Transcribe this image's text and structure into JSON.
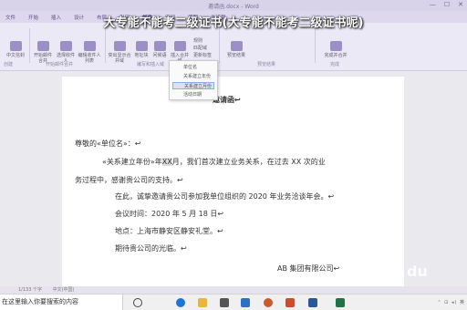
{
  "overlay_title": "大专能不能考二级证书(大专能不能考二级证书呢)",
  "window": {
    "title": "邀请函.docx - Word",
    "controls": [
      "—",
      "☐",
      "✕"
    ]
  },
  "menu": [
    "文件",
    "开始",
    "插入",
    "设计",
    "布局",
    "引用",
    "邮件",
    "审阅",
    "视图",
    "告诉我"
  ],
  "ribbon": {
    "buttons": [
      {
        "label": "中文信封",
        "icon": "envelope-icon"
      },
      {
        "label": "开始邮件合并",
        "icon": "mail-merge-icon"
      },
      {
        "label": "选择收件人",
        "icon": "recipients-icon"
      },
      {
        "label": "编辑收件人列表",
        "icon": "edit-list-icon"
      },
      {
        "label": "突出显示合并域",
        "icon": "highlight-fields-icon"
      },
      {
        "label": "地址块",
        "icon": "address-block-icon"
      },
      {
        "label": "问候语",
        "icon": "greeting-icon"
      },
      {
        "label": "插入合并域",
        "icon": "insert-field-icon"
      },
      {
        "label": "完成并合并",
        "icon": "finish-merge-icon"
      }
    ],
    "checks": [
      "规则",
      "匹配域",
      "更新标签"
    ],
    "preview_label": "预览结果",
    "groups": [
      "创建",
      "开始邮件合并",
      "编写和插入域",
      "预览结果",
      "完成"
    ]
  },
  "dropdown": {
    "items": [
      "单位名",
      "关系建立年份",
      "关系建立月份",
      "活动日期"
    ],
    "selected_index": 2
  },
  "document": {
    "title": "邀请函↩",
    "salutation": "尊敬的«单位名»：↩",
    "para1a": "«关系建立年份»年",
    "para1_month": "XX",
    "para1b": "月，我们首次建立业务关系，在过去 XX 次的业",
    "para1c": "务过程中，感谢贵公司的支持。↩",
    "para2": "在此，诚挚邀请贵公司参加我单位组织的 2020 年业务洽谈年会。↩",
    "time": "会议时间：2020 年 5 月 18 日↩",
    "place": "地点：上海市静安区静安礼堂。↩",
    "closing": "期待贵公司的光临。↩",
    "signature": "AB 集团有限公司↩"
  },
  "status": [
    "1/133 个字",
    "中文(中国)"
  ],
  "taskbar": {
    "search_text": "在这里输入你要搜索的内容",
    "icons": [
      {
        "name": "task-view-icon",
        "color": "#444444"
      },
      {
        "name": "edge-icon",
        "color": "#1e73d6"
      },
      {
        "name": "file-explorer-icon",
        "color": "#e9b53c"
      },
      {
        "name": "store-icon",
        "color": "#555555"
      },
      {
        "name": "mail-icon",
        "color": "#2b71c4"
      },
      {
        "name": "photos-icon",
        "color": "#c85a2c"
      },
      {
        "name": "powerpoint-icon",
        "color": "#c94f2d"
      },
      {
        "name": "word-icon",
        "color": "#2b579a"
      },
      {
        "name": "excel-icon",
        "color": "#217346"
      }
    ],
    "tray": "⌃ ⊡ ◂) 英"
  },
  "watermark": "Bai du"
}
